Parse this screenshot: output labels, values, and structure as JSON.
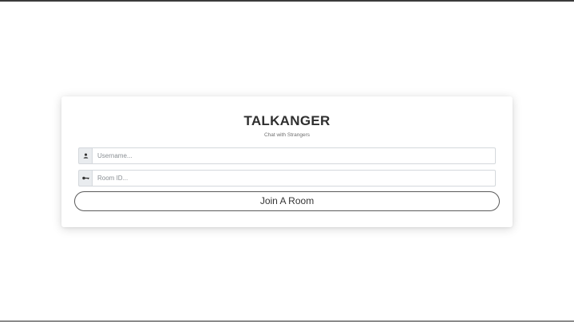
{
  "app": {
    "title": "TALKANGER",
    "subtitle": "Chat with Strangers"
  },
  "form": {
    "username": {
      "placeholder": "Username...",
      "value": "",
      "icon": "user-icon"
    },
    "room_id": {
      "placeholder": "Room ID...",
      "value": "",
      "icon": "key-icon"
    },
    "join_label": "Join A Room"
  },
  "colors": {
    "background": "#ffffff",
    "addon": "#e9ecef",
    "border": "#d4d8dc",
    "text": "#333333"
  }
}
